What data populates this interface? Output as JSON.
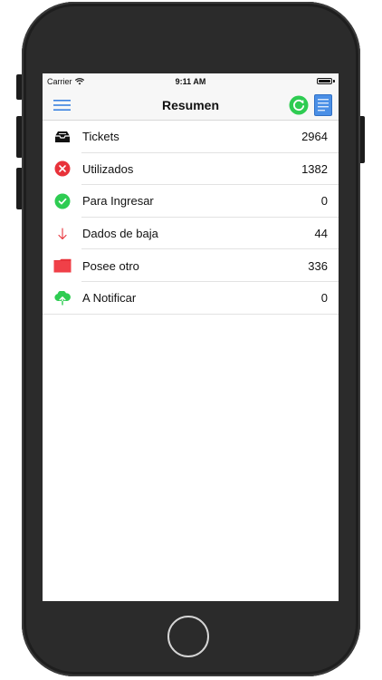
{
  "status_bar": {
    "carrier": "Carrier",
    "time": "9:11 AM"
  },
  "nav_bar": {
    "title": "Resumen",
    "left_icon": "hamburger-menu-icon",
    "right_icons": [
      "refresh-icon",
      "document-icon"
    ]
  },
  "colors": {
    "accent_blue": "#3b82e0",
    "green": "#2ecc52",
    "red": "#e8323a",
    "nav_bg": "#f7f7f7"
  },
  "summary": {
    "items": [
      {
        "label": "Tickets",
        "value": "2964",
        "icon": "inbox-tray-icon"
      },
      {
        "label": "Utilizados",
        "value": "1382",
        "icon": "red-x-circle-icon"
      },
      {
        "label": "Para Ingresar",
        "value": "0",
        "icon": "green-check-circle-icon"
      },
      {
        "label": "Dados de baja",
        "value": "44",
        "icon": "down-arrow-icon"
      },
      {
        "label": "Posee otro",
        "value": "336",
        "icon": "red-folder-icon"
      },
      {
        "label": "A Notificar",
        "value": "0",
        "icon": "cloud-upload-icon"
      }
    ]
  }
}
